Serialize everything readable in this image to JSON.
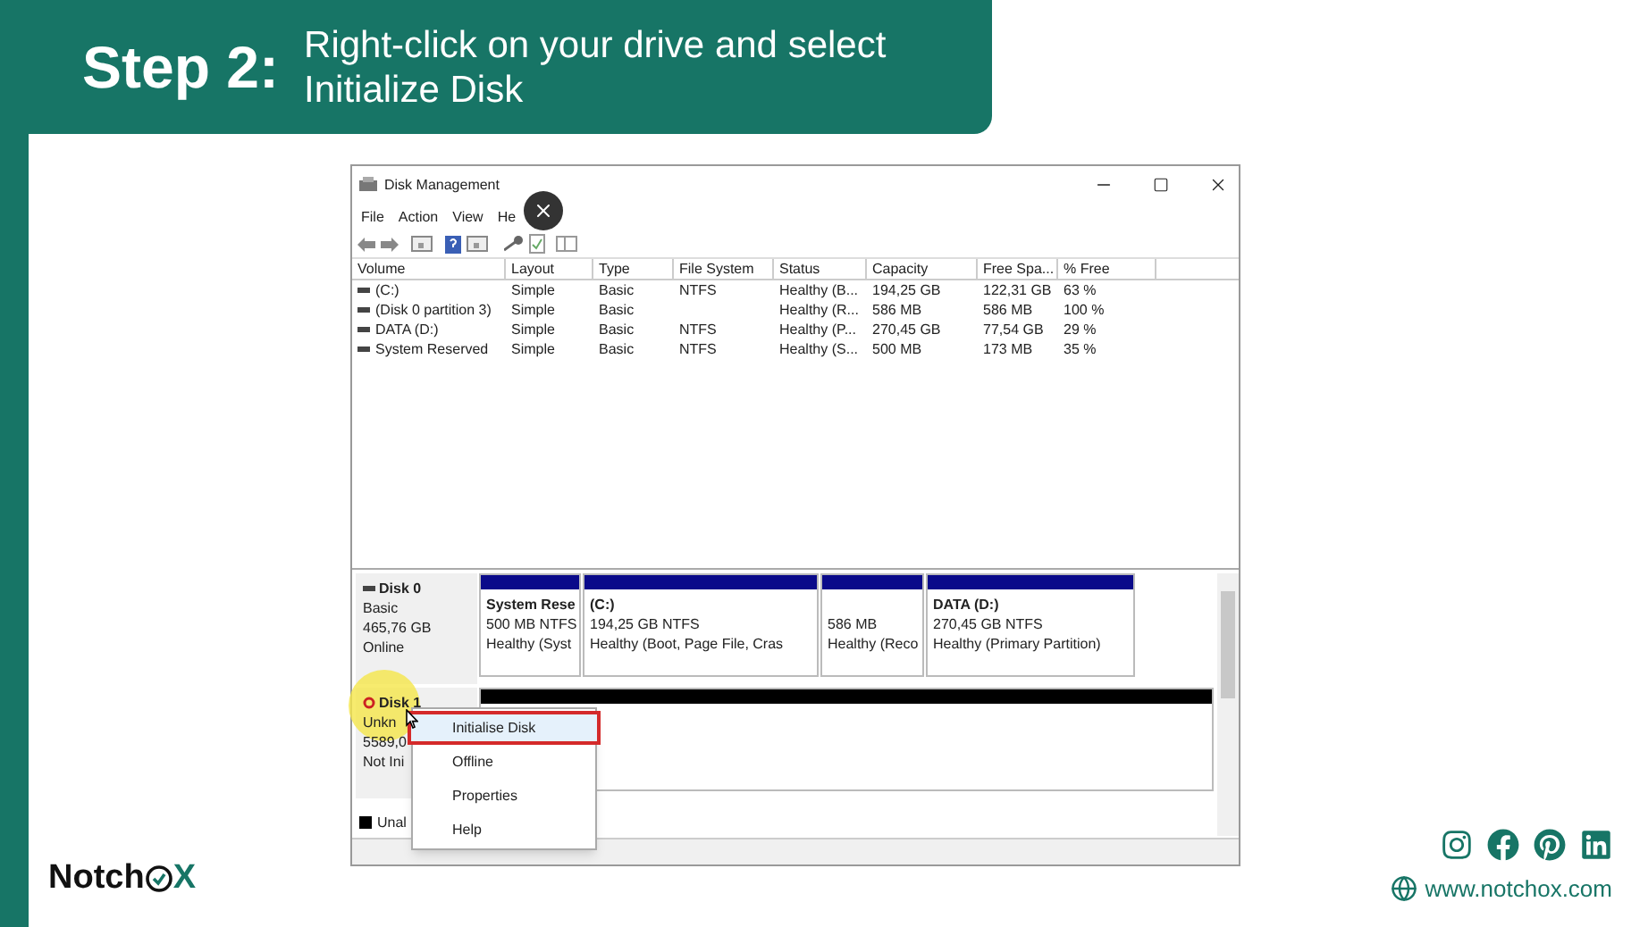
{
  "header": {
    "step": "Step 2:",
    "text": "Right-click on your drive and select Initialize Disk"
  },
  "window": {
    "title": "Disk Management",
    "menu": [
      "File",
      "Action",
      "View",
      "He"
    ]
  },
  "volumes": {
    "columns": [
      "Volume",
      "Layout",
      "Type",
      "File System",
      "Status",
      "Capacity",
      "Free Spa...",
      "% Free"
    ],
    "rows": [
      [
        "(C:)",
        "Simple",
        "Basic",
        "NTFS",
        "Healthy (B...",
        "194,25 GB",
        "122,31 GB",
        "63 %"
      ],
      [
        "(Disk 0 partition 3)",
        "Simple",
        "Basic",
        "",
        "Healthy (R...",
        "586 MB",
        "586 MB",
        "100 %"
      ],
      [
        "DATA (D:)",
        "Simple",
        "Basic",
        "NTFS",
        "Healthy (P...",
        "270,45 GB",
        "77,54 GB",
        "29 %"
      ],
      [
        "System Reserved",
        "Simple",
        "Basic",
        "NTFS",
        "Healthy (S...",
        "500 MB",
        "173 MB",
        "35 %"
      ]
    ]
  },
  "disks": [
    {
      "kind": "online",
      "name": "Disk 0",
      "lines": [
        "Basic",
        "465,76 GB",
        "Online"
      ],
      "partitions": [
        {
          "name": "System Rese",
          "lines": [
            "500 MB NTFS",
            "Healthy (Syst"
          ]
        },
        {
          "name": "(C:)",
          "lines": [
            "194,25 GB NTFS",
            "Healthy (Boot, Page File, Cras"
          ]
        },
        {
          "lines": [
            "586 MB",
            "Healthy (Reco"
          ]
        },
        {
          "name": "DATA  (D:)",
          "lines": [
            "270,45 GB NTFS",
            "Healthy (Primary Partition)"
          ]
        }
      ]
    },
    {
      "kind": "uninitialized",
      "name": "Disk 1",
      "lines": [
        "Unkn",
        "5589,0",
        "Not Ini"
      ]
    }
  ],
  "legend": [
    "Unal"
  ],
  "context_menu": {
    "items": [
      {
        "label": "Initialise Disk",
        "selected": true
      },
      {
        "label": "Offline",
        "selected": false
      },
      {
        "label": "Properties",
        "selected": false
      },
      {
        "label": "Help",
        "selected": false
      }
    ]
  },
  "footer": {
    "logo_before": "Notch",
    "logo_after": "X",
    "website": "www.notchox.com"
  }
}
